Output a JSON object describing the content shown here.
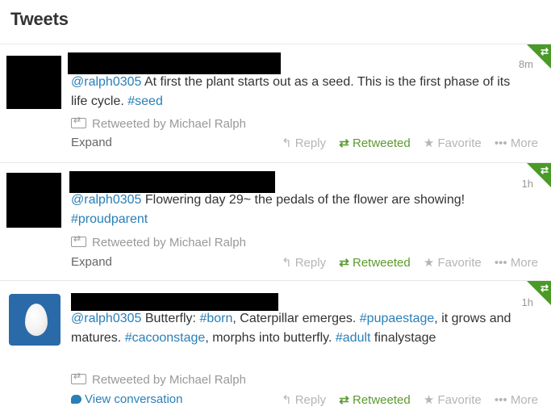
{
  "header": {
    "title": "Tweets"
  },
  "colors": {
    "link": "#2a7fb8",
    "retweeted": "#5c9a2e",
    "corner": "#4a9a28",
    "muted": "#999999"
  },
  "tweets": [
    {
      "time": "8m",
      "mention": "@ralph0305",
      "text_parts": [
        " At first the plant starts out as a seed. This is the first phase of its life cycle. ",
        "#seed"
      ],
      "retweeted_by": "Retweeted by Michael Ralph",
      "footer_link": "Expand",
      "actions": {
        "reply": "Reply",
        "retweeted": "Retweeted",
        "favorite": "Favorite",
        "more": "More"
      }
    },
    {
      "time": "1h",
      "mention": "@ralph0305",
      "text_parts": [
        " Flowering day 29~ the pedals of the flower are showing! ",
        "#proudparent"
      ],
      "retweeted_by": "Retweeted by Michael Ralph",
      "footer_link": "Expand",
      "actions": {
        "reply": "Reply",
        "retweeted": "Retweeted",
        "favorite": "Favorite",
        "more": "More"
      }
    },
    {
      "time": "1h",
      "mention": "@ralph0305",
      "text_parts": [
        " Butterfly: ",
        "#born",
        ", Caterpillar emerges. ",
        "#pupaestage",
        ", it grows and matures. ",
        "#cacoonstage",
        ", morphs into butterfly. ",
        "#adult",
        " finalystage"
      ],
      "retweeted_by": "Retweeted by Michael Ralph",
      "footer_link": "View conversation",
      "actions": {
        "reply": "Reply",
        "retweeted": "Retweeted",
        "favorite": "Favorite",
        "more": "More"
      }
    }
  ]
}
